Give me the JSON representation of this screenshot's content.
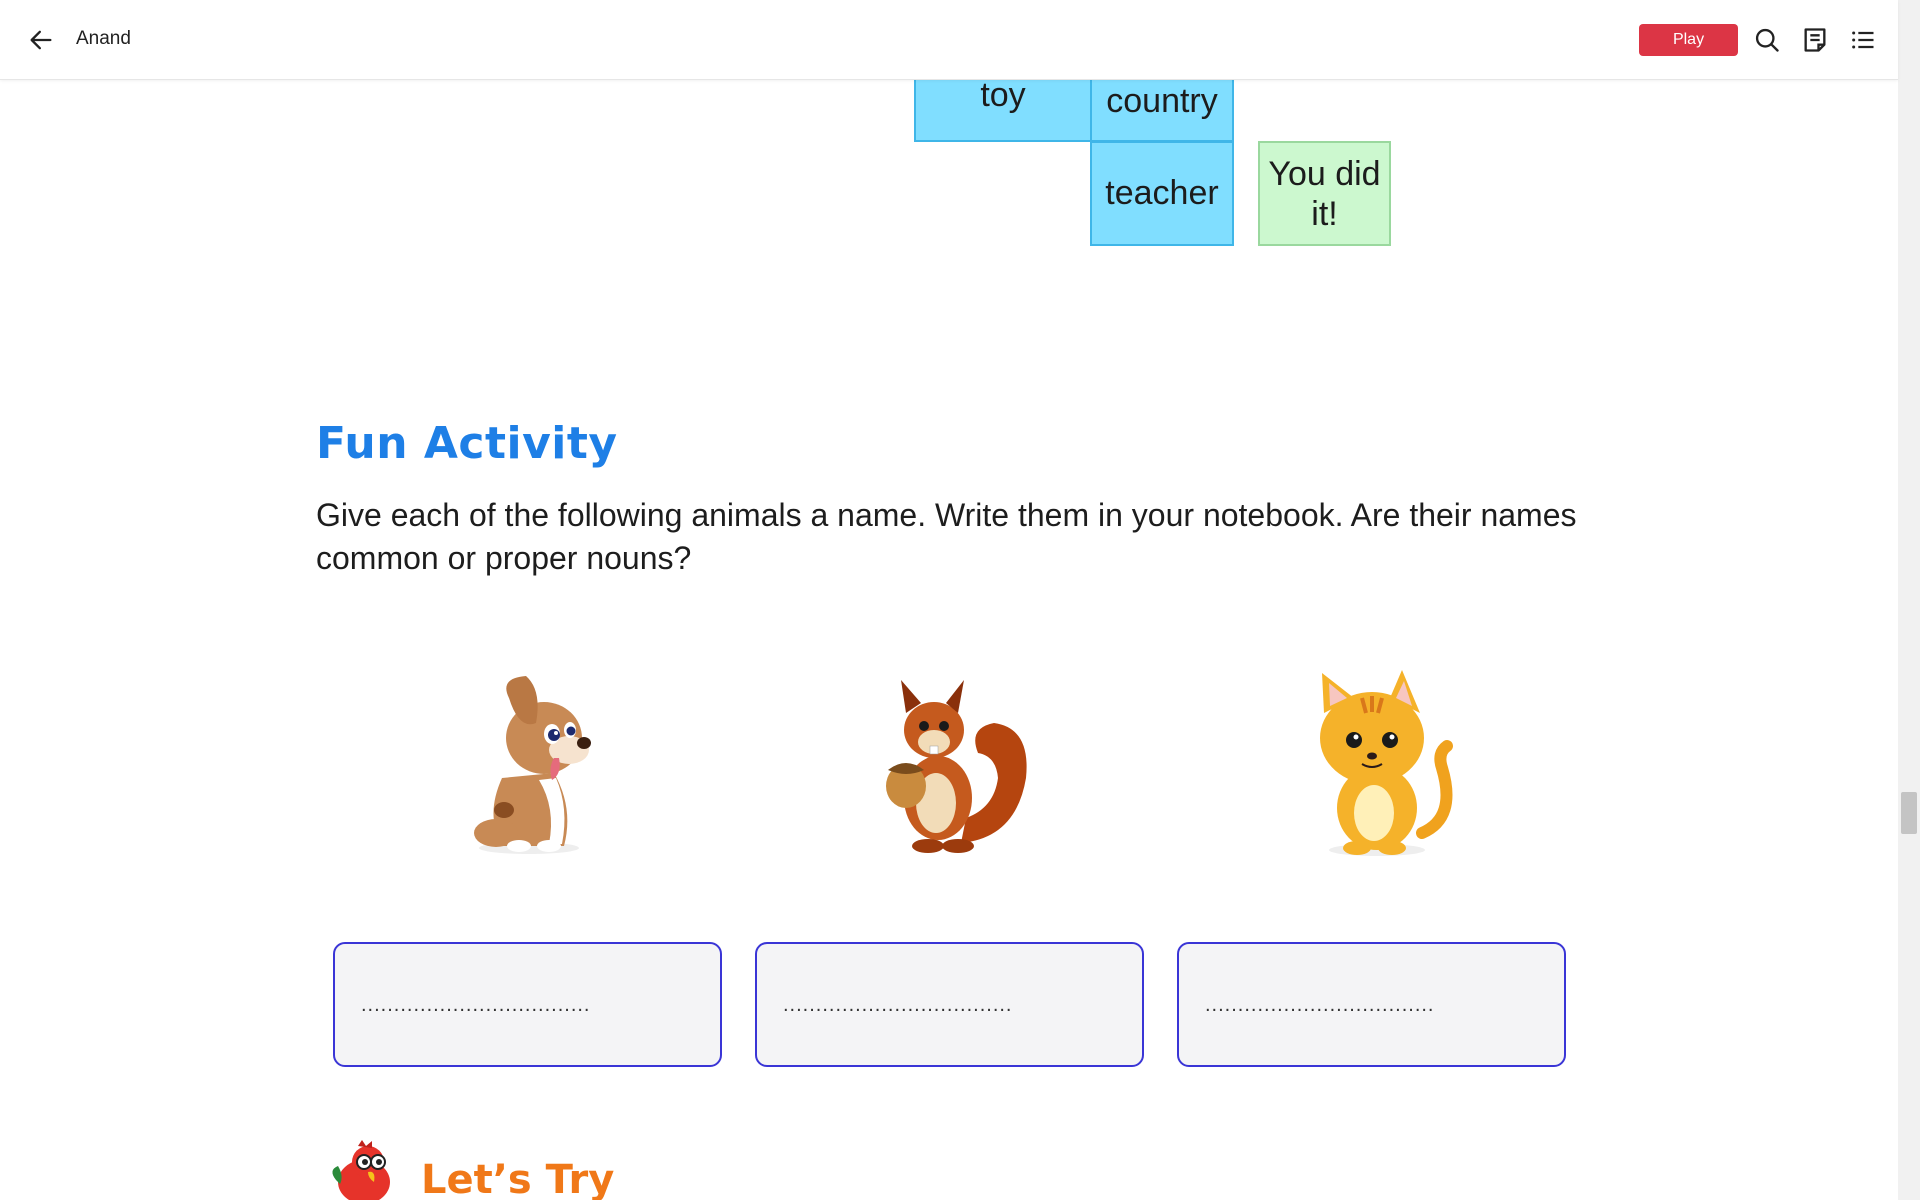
{
  "header": {
    "title": "Anand",
    "play_label": "Play",
    "icons": [
      "back-arrow-icon",
      "search-icon",
      "notes-icon",
      "list-icon"
    ]
  },
  "word_grid": {
    "cells": [
      "toy",
      "country",
      "teacher"
    ],
    "success_message": "You did it!"
  },
  "activity": {
    "heading": "Fun Activity",
    "instruction": "Give each of the following animals a name. Write them in your notebook. Are their names common or proper nouns?",
    "animals": [
      "dog",
      "squirrel",
      "cat"
    ],
    "answer_placeholders": [
      "...................................",
      "...................................",
      "..................................."
    ]
  },
  "next_section": {
    "heading": "Let’s Try"
  },
  "colors": {
    "cell_blue": "#80deff",
    "success_green": "#ccf8cf",
    "heading_blue": "#1e7fe6",
    "play_red": "#dc3545",
    "box_border": "#3a35d6",
    "lets_try_orange": "#f07818"
  }
}
